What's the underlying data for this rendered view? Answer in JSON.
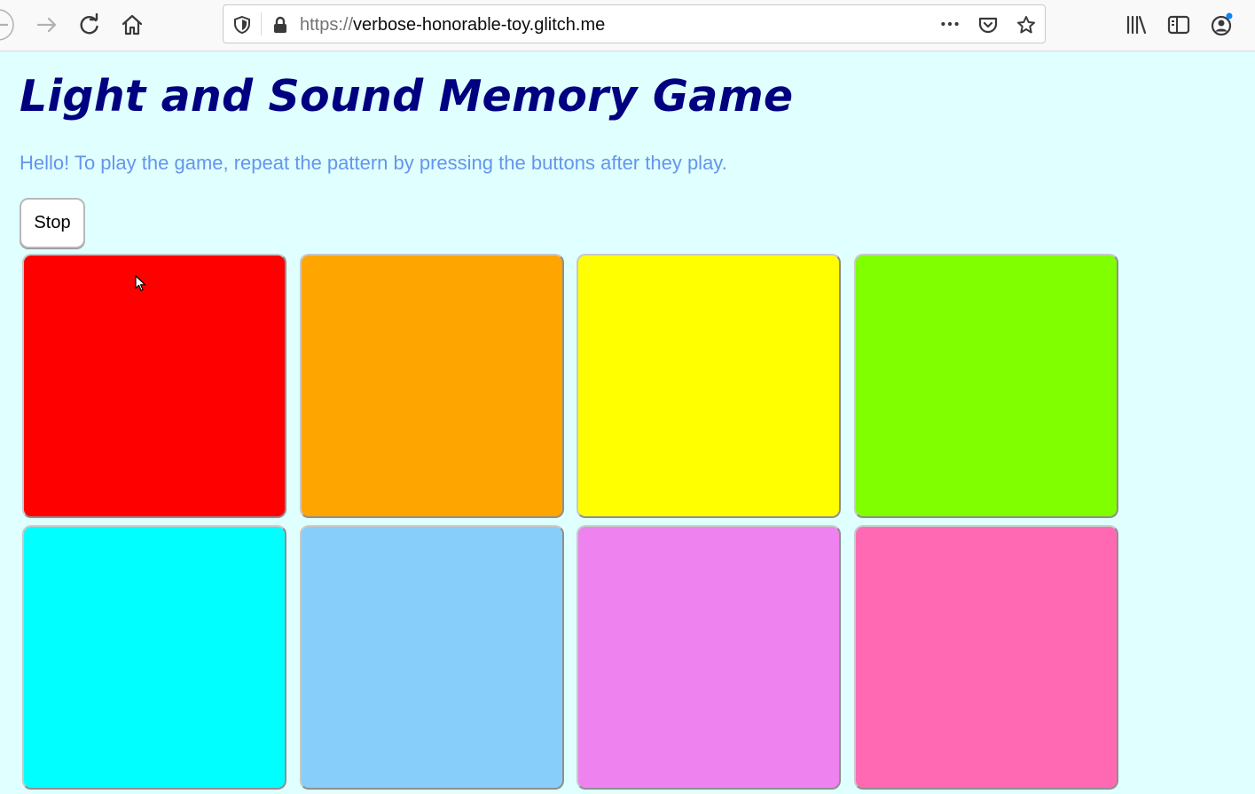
{
  "browser": {
    "url_scheme": "https://",
    "url_host": "verbose-honorable-toy.glitch.me"
  },
  "page": {
    "title": "Light and Sound Memory Game",
    "intro": "Hello! To play the game, repeat the pattern by pressing the buttons after they play.",
    "stop_label": "Stop"
  },
  "pads": [
    {
      "color": "#ff0000"
    },
    {
      "color": "#ffa500"
    },
    {
      "color": "#ffff00"
    },
    {
      "color": "#7fff00"
    },
    {
      "color": "#00ffff"
    },
    {
      "color": "#87cefa"
    },
    {
      "color": "#ee82ee"
    },
    {
      "color": "#ff69b4"
    }
  ]
}
